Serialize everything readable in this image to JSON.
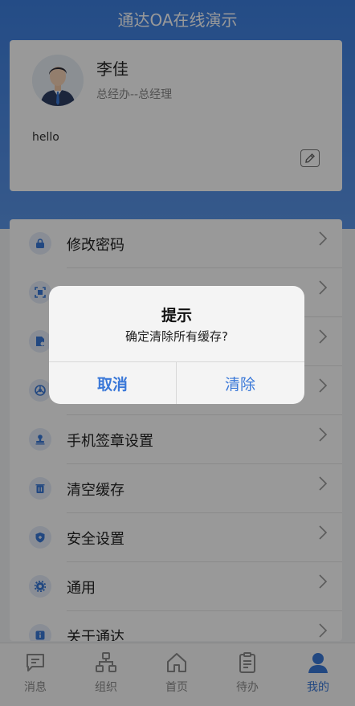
{
  "header": {
    "title": "通达OA在线演示"
  },
  "profile": {
    "name": "李佳",
    "department": "总经办--总经理",
    "signature": "hello"
  },
  "menu": {
    "items": [
      {
        "label": "修改密码",
        "icon": "lock-icon"
      },
      {
        "label": "",
        "icon": "scan-icon"
      },
      {
        "label": "",
        "icon": "document-icon"
      },
      {
        "label": "",
        "icon": "browser-icon"
      },
      {
        "label": "手机签章设置",
        "icon": "stamp-icon"
      },
      {
        "label": "清空缓存",
        "icon": "trash-icon"
      },
      {
        "label": "安全设置",
        "icon": "shield-icon"
      },
      {
        "label": "通用",
        "icon": "gear-icon"
      },
      {
        "label": "关于通达",
        "icon": "info-icon"
      }
    ]
  },
  "tabbar": {
    "tabs": [
      {
        "label": "消息",
        "icon": "message-icon"
      },
      {
        "label": "组织",
        "icon": "org-icon"
      },
      {
        "label": "首页",
        "icon": "home-icon"
      },
      {
        "label": "待办",
        "icon": "clipboard-icon"
      },
      {
        "label": "我的",
        "icon": "user-icon",
        "active": true
      }
    ]
  },
  "dialog": {
    "title": "提示",
    "message": "确定清除所有缓存?",
    "cancel_label": "取消",
    "confirm_label": "清除"
  },
  "colors": {
    "accent": "#3a78d8",
    "header": "#3d7fe0"
  }
}
